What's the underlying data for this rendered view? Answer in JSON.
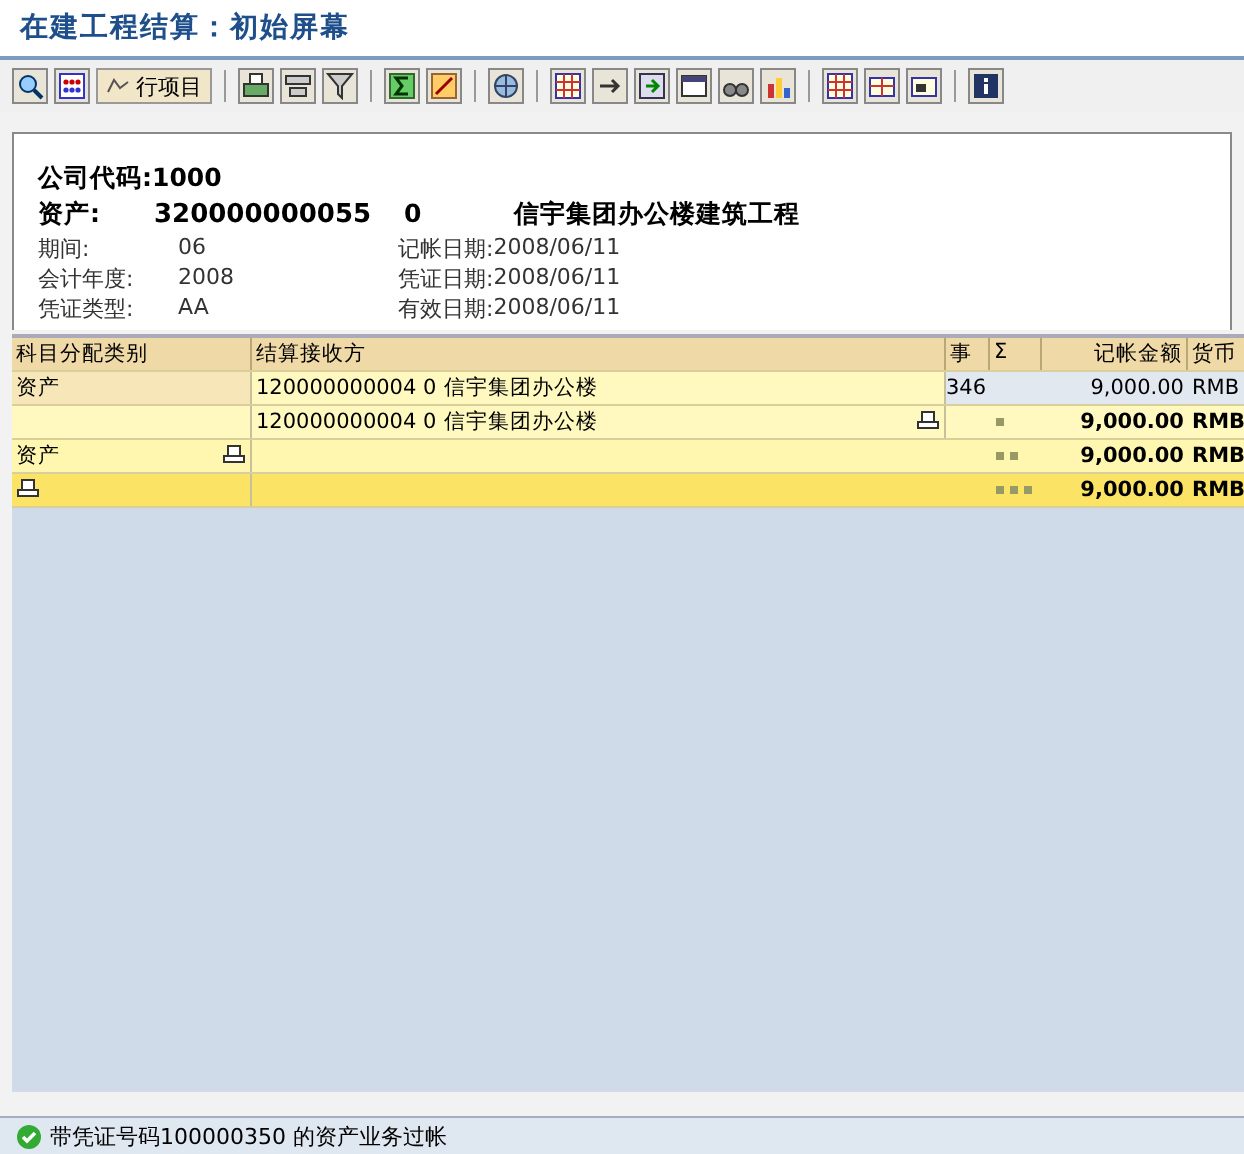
{
  "window": {
    "title": "在建工程结算：初始屏幕"
  },
  "toolbar": {
    "line_items_button": "行项目"
  },
  "header": {
    "company_code": {
      "label": "公司代码:",
      "value": "1000"
    },
    "asset": {
      "label": "资产:",
      "number": "320000000055",
      "sub_number": "0",
      "description": "信宇集团办公楼建筑工程"
    },
    "fields": [
      {
        "label": "期间:",
        "value": "06"
      },
      {
        "label": "记帐日期:",
        "value": "2008/06/11"
      },
      {
        "label": "会计年度:",
        "value": "2008"
      },
      {
        "label": "凭证日期:",
        "value": "2008/06/11"
      },
      {
        "label": "凭证类型:",
        "value": "AA"
      },
      {
        "label": "有效日期:",
        "value": "2008/06/11"
      }
    ]
  },
  "table": {
    "columns": [
      "科目分配类别",
      "结算接收方",
      "事",
      "Σ",
      "记帐金额",
      "货币"
    ],
    "rows": [
      {
        "kind": "item",
        "category": "资产",
        "receiver_number": "120000000004 0",
        "receiver_name": "信宇集团办公楼",
        "transaction": "346",
        "amount": "9,000.00",
        "currency": "RMB"
      },
      {
        "kind": "subtotal1",
        "receiver_number": "120000000004 0",
        "receiver_name": "信宇集团办公楼",
        "amount": "9,000.00",
        "currency": "RMB"
      },
      {
        "kind": "subtotal2",
        "category": "资产",
        "amount": "9,000.00",
        "currency": "RMB"
      },
      {
        "kind": "total",
        "amount": "9,000.00",
        "currency": "RMB"
      }
    ]
  },
  "status_bar": {
    "message": "带凭证号码100000350 的资产业务过帐"
  }
}
